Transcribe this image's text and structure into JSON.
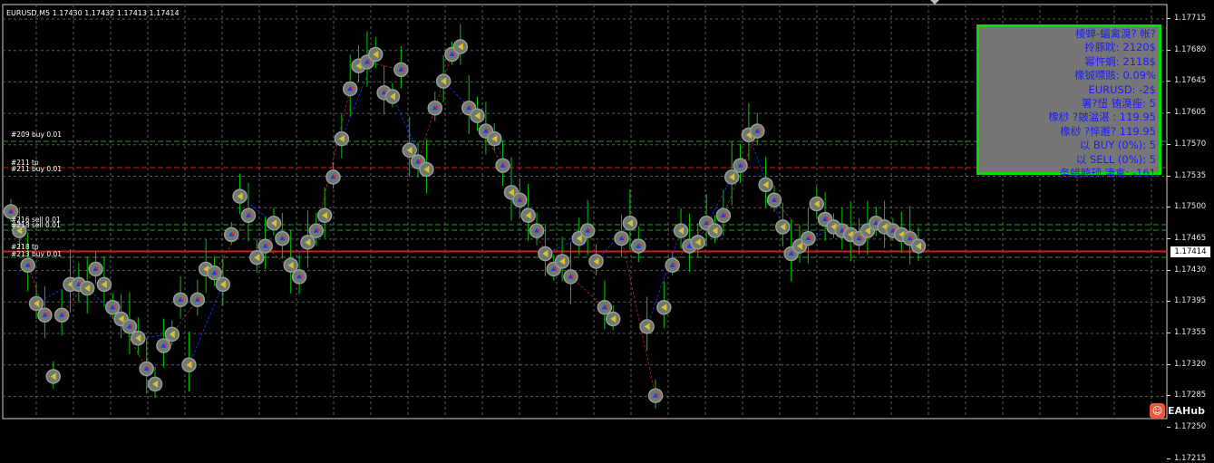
{
  "window": {
    "symbol_info": "EURUSD,M5  1.17430 1.17432 1.17413 1.17414"
  },
  "price_scale": {
    "ticks": [
      "1.17715",
      "1.17680",
      "1.17645",
      "1.17605",
      "1.17570",
      "1.17535",
      "1.17500",
      "1.17465",
      "1.17430",
      "1.17395",
      "1.17355",
      "1.17320",
      "1.17285",
      "1.17250",
      "1.17215"
    ],
    "current_price": "1.17414"
  },
  "order_labels": [
    {
      "text": "#209 buy 0.01",
      "line": "buy_top"
    },
    {
      "text": "#211 tp",
      "line": "red_mid"
    },
    {
      "text": "#211 buy 0.01",
      "line": "red_mid_sub"
    },
    {
      "text": "#216 sell 0.01",
      "line": "sell_a"
    },
    {
      "text": "#218 sell 0.01",
      "line": "sell_b"
    },
    {
      "text": "#218 tp",
      "line": "red_low"
    },
    {
      "text": "#213 buy 0.01",
      "line": "buy_low"
    }
  ],
  "info_panel": {
    "lines": [
      "棱蝉-蝠禽溴? 帐?",
      "拎豚眈: 2120$",
      "幂忤蜩: 2118$",
      "橡铖嘌赅: 0.09%",
      "EURUSD: -2$",
      "署?忸 铕溴痤: 5",
      "橡桫    ?皴湓湛     : 119.95",
      "橡桫    ?悴邂? 119.95",
      "以 BUY (0%): 5",
      "以 SELL (0%): 5",
      "务蜡腩顸 凄禽: -161"
    ]
  },
  "watermark": {
    "text": "EAHub"
  },
  "colors": {
    "background": "#000000",
    "grid": "#5a5a5a",
    "candle": "#00c800",
    "buy_line": "#2f8f2f",
    "tp_line": "#c82020",
    "buy_arrow": "#1a36ff",
    "sell_arrow": "#ff2020",
    "marker_ring": "#9a9a9a",
    "panel_border": "#00e000",
    "panel_text": "#1d1dff",
    "panel_bg": "#767676"
  },
  "chart_data": {
    "type": "line",
    "title": "",
    "xlabel": "",
    "ylabel": "",
    "symbol": "EURUSD",
    "timeframe": "M5",
    "ylim": [
      1.17195,
      1.17735
    ],
    "series": [
      {
        "values": [
          1.17465,
          1.1744,
          1.17395,
          1.17345,
          1.1733,
          1.1725,
          1.1733,
          1.1737,
          1.1737,
          1.17365,
          1.1739,
          1.1737,
          1.1734,
          1.17325,
          1.17315,
          1.173,
          1.1726,
          1.1724,
          1.1729,
          1.17305,
          1.1735,
          1.17265,
          1.1735,
          1.1739,
          1.17385,
          1.1737,
          1.17435,
          1.17485,
          1.1746,
          1.17405,
          1.1742,
          1.1745,
          1.1743,
          1.17395,
          1.1738,
          1.17425,
          1.1744,
          1.1746,
          1.1751,
          1.1756,
          1.17625,
          1.17655,
          1.1766,
          1.1767,
          1.1762,
          1.17615,
          1.1765,
          1.17545,
          1.1753,
          1.1752,
          1.176,
          1.17635,
          1.1767,
          1.1768,
          1.176,
          1.1759,
          1.1757,
          1.1756,
          1.17525,
          1.1749,
          1.1748,
          1.1746,
          1.1744,
          1.1741,
          1.1739,
          1.174,
          1.1738,
          1.1743,
          1.1744,
          1.174,
          1.1734,
          1.17325,
          1.1743,
          1.1745,
          1.1742,
          1.17315,
          1.17225,
          1.1734,
          1.17395,
          1.1744,
          1.1742,
          1.17425,
          1.1745,
          1.1744,
          1.1746,
          1.1751,
          1.17525,
          1.17565,
          1.1757,
          1.175,
          1.1748,
          1.17445,
          1.1741,
          1.1742,
          1.1743,
          1.17475,
          1.17455,
          1.17445,
          1.1744,
          1.17435,
          1.1743,
          1.1744,
          1.1745,
          1.17445,
          1.1744,
          1.17435,
          1.1743,
          1.1742
        ]
      }
    ],
    "grid": true,
    "order_levels": [
      {
        "label": "#209 buy 0.01",
        "price": 1.17555,
        "type": "buy"
      },
      {
        "label": "#211 tp",
        "price": 1.17522,
        "type": "tp"
      },
      {
        "label": "#216 sell 0.01",
        "price": 1.17453,
        "type": "sell"
      },
      {
        "label": "#218 sell 0.01",
        "price": 1.17445,
        "type": "sell"
      },
      {
        "label": "#218 tp",
        "price": 1.17418,
        "type": "tp"
      },
      {
        "label": "#213 buy 0.01",
        "price": 1.17405,
        "type": "buy"
      }
    ]
  }
}
